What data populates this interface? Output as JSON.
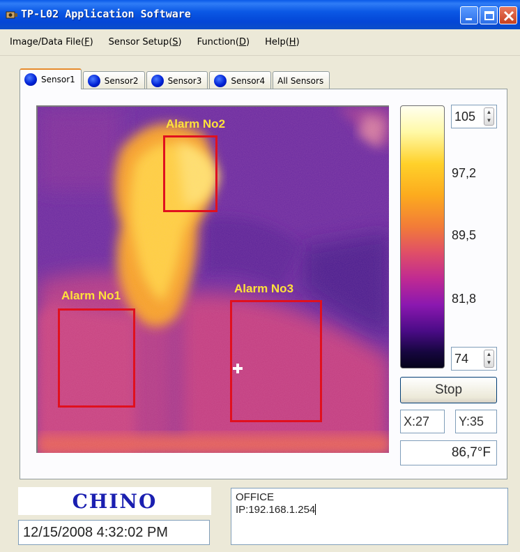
{
  "window": {
    "title": "TP-L02 Application Software",
    "icon": "thermal-camera-icon"
  },
  "menu": [
    {
      "label": "Image/Data File(",
      "key": "F",
      "suffix": ")"
    },
    {
      "label": "Sensor Setup(",
      "key": "S",
      "suffix": ")"
    },
    {
      "label": "Function(",
      "key": "D",
      "suffix": ")"
    },
    {
      "label": "Help(",
      "key": "H",
      "suffix": ")"
    }
  ],
  "tabs": [
    {
      "label": "Sensor1",
      "active": true
    },
    {
      "label": "Sensor2",
      "active": false
    },
    {
      "label": "Sensor3",
      "active": false
    },
    {
      "label": "Sensor4",
      "active": false
    },
    {
      "label": "All Sensors",
      "active": false
    }
  ],
  "alarms": [
    {
      "label": "Alarm No1"
    },
    {
      "label": "Alarm No2"
    },
    {
      "label": "Alarm No3"
    }
  ],
  "scale": {
    "max_value": "105",
    "min_value": "74",
    "ticks": [
      "97,2",
      "89,5",
      "81,8"
    ]
  },
  "controls": {
    "stop_label": "Stop",
    "x_readout": "X:27",
    "y_readout": "Y:35",
    "temperature": "86,7°F"
  },
  "footer": {
    "logo": "CHINO",
    "datetime": "12/15/2008 4:32:02 PM",
    "info_line1": "OFFICE",
    "info_line2": "IP:192.168.1.254"
  },
  "colors": {
    "titlebar": "#0346d6",
    "alarm_box": "#e0101e",
    "alarm_label": "#ffe23a",
    "logo": "#1a1fb0"
  }
}
